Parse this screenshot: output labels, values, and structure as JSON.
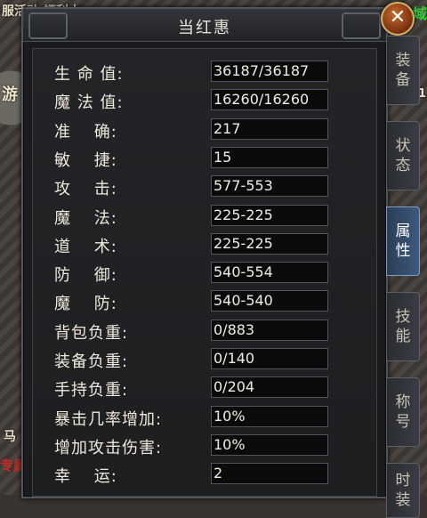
{
  "window": {
    "title": "当红惠"
  },
  "background": {
    "top_text": "服活动 福利大",
    "left_text": "游",
    "left_bottom_text": "专属",
    "side_text": "马",
    "green_text": "域",
    "right_num": "1"
  },
  "stats": [
    {
      "label": "生 命 值:",
      "value": "36187/36187"
    },
    {
      "label": "魔 法 值:",
      "value": "16260/16260"
    },
    {
      "label": "准　 确:",
      "value": "217"
    },
    {
      "label": "敏　 捷:",
      "value": "15"
    },
    {
      "label": "攻　 击:",
      "value": "577-553"
    },
    {
      "label": "魔　 法:",
      "value": "225-225"
    },
    {
      "label": "道　 术:",
      "value": "225-225"
    },
    {
      "label": "防　 御:",
      "value": "540-554"
    },
    {
      "label": "魔　 防:",
      "value": "540-540"
    },
    {
      "label": "背包负重:",
      "value": "0/883"
    },
    {
      "label": "装备负重:",
      "value": "0/140"
    },
    {
      "label": "手持负重:",
      "value": "0/204"
    },
    {
      "label": "暴击几率增加:",
      "value": "10%"
    },
    {
      "label": "增加攻击伤害:",
      "value": "10%"
    },
    {
      "label": "幸　 运:",
      "value": "2"
    }
  ],
  "tabs": [
    {
      "chars": [
        "装",
        "备"
      ],
      "active": false
    },
    {
      "chars": [
        "状",
        "态"
      ],
      "active": false
    },
    {
      "chars": [
        "属",
        "性"
      ],
      "active": true
    },
    {
      "chars": [
        "技",
        "能"
      ],
      "active": false
    },
    {
      "chars": [
        "称",
        "号"
      ],
      "active": false
    },
    {
      "chars": [
        "时",
        "装"
      ],
      "active": false
    }
  ],
  "close_icon": "close-icon",
  "colors": {
    "active_tab": "#3d5a7e",
    "close_button": "#c36a2c"
  }
}
